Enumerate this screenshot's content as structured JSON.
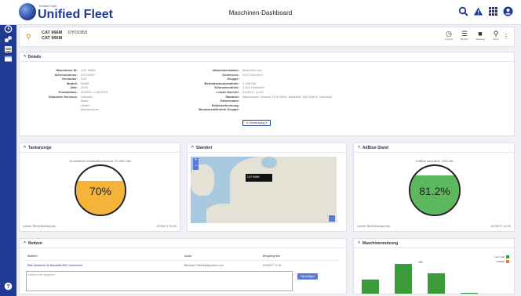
{
  "sidebar": {
    "icons": [
      "menu-icon",
      "dashboard-icon",
      "machines-icon",
      "list-icon",
      "report-icon",
      "help-icon"
    ]
  },
  "header": {
    "brand_small": "Trimble Fleet",
    "brand": "Unified Fleet",
    "title": "Maschinen-Dashboard",
    "icons": [
      "search-icon",
      "alert-icon",
      "apps-icon",
      "account-icon"
    ]
  },
  "machine": {
    "name": "CAT 966M",
    "model": "CAT 966M",
    "id": "DYO1959",
    "actions": [
      {
        "icon": "clock-icon",
        "label": "Uhrzeit"
      },
      {
        "icon": "list-icon",
        "label": "Bericht"
      },
      {
        "icon": "box-icon",
        "label": "Wartung"
      },
      {
        "icon": "pin-icon",
        "label": "Karte"
      }
    ]
  },
  "details": {
    "title": "Details",
    "left": [
      {
        "l": "Maschinen-ID:",
        "v": "CAT 966M"
      },
      {
        "l": "Seriennummer:",
        "v": "DYO1959"
      },
      {
        "l": "Hersteller:",
        "v": "CAT"
      },
      {
        "l": "Modell:",
        "v": "966M"
      },
      {
        "l": "Jahr:",
        "v": "2016"
      },
      {
        "l": "Produktlinie:",
        "v": "WHEEL LOADERS"
      },
      {
        "l": "Gebuchte Services:",
        "v": "Ultimate"
      },
      {
        "l": "",
        "v": "Basic"
      },
      {
        "l": "",
        "v": "Health"
      },
      {
        "l": "",
        "v": "Maintenance"
      }
    ],
    "right": [
      {
        "l": "Maschinenstatus:",
        "v": "Maschine aus"
      },
      {
        "l": "Geofences:",
        "v": "Seit 5 Wochen"
      },
      {
        "l": "Gruppe:",
        "v": "-"
      },
      {
        "l": "Betriebsstundenzähler:",
        "v": "2.168 Std"
      },
      {
        "l": "Kilometerzähler:",
        "v": "3.301 Kilometer"
      },
      {
        "l": "Letzter Bericht:",
        "v": "01/30/17 14:30"
      },
      {
        "l": "Standort:",
        "v": "Neumünster Strasse 23 M-5030, Bielefeld, NW 33613, Germany"
      },
      {
        "l": "Fahrername:",
        "v": "-"
      },
      {
        "l": "Bedienerkennung:",
        "v": "-"
      },
      {
        "l": "Benutzerdefinierte Gruppe:",
        "v": ""
      }
    ],
    "select": "In Verwendung"
  },
  "tank": {
    "title": "Tankanzeige",
    "label": "Kumulierter Kraftstoffverbrauch: 23.406 Liter",
    "value": "70%",
    "pct": 0.7,
    "color": "#f6b33a",
    "footer_l": "Letzter Berichtszeitpunkt:",
    "footer_r": "01/30/17 14:30"
  },
  "location": {
    "title": "Standort",
    "pin": "CAT 966M"
  },
  "adblue": {
    "title": "AdBlue-Stand",
    "label": "AdBlue kumuliert: 195 Liter",
    "value": "81.2%",
    "pct": 0.812,
    "color": "#5cb85c",
    "footer_l": "Letzter Berichtszeitpunkt:",
    "footer_r": "01/30/17 14:30"
  },
  "notes": {
    "title": "Notizen",
    "cols": [
      "Notizen",
      "Autor",
      "Eingelegt am"
    ],
    "row": {
      "note": "Bitte Maschine für Baustelle ABC reservieren",
      "author": "Bernhard Tabert@appstore.com",
      "date": "01/30/17 17:15"
    },
    "placeholder": "Notizen hier eingeben",
    "button": "Hinzufügen"
  },
  "usage": {
    "title": "Maschinennutzung",
    "legend": [
      "Leer Lauf",
      "Lastlauf"
    ],
    "colors": [
      "#3b9b3b",
      "#e87d2b"
    ],
    "bars": [
      12,
      26,
      18,
      0.5
    ],
    "top_label": "336"
  }
}
